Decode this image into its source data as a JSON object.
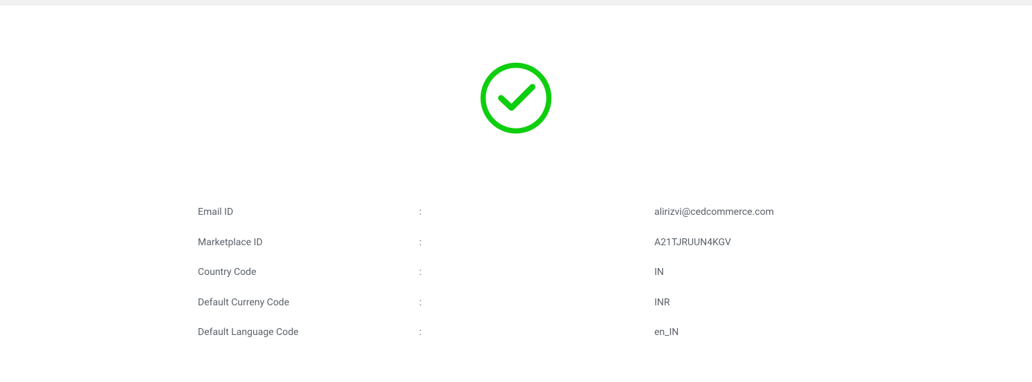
{
  "icon": {
    "color": "#0fce0f"
  },
  "details": {
    "rows": [
      {
        "label": "Email ID",
        "sep": ":",
        "value": "alirizvi@cedcommerce.com"
      },
      {
        "label": "Marketplace ID",
        "sep": ":",
        "value": "A21TJRUUN4KGV"
      },
      {
        "label": "Country Code",
        "sep": ":",
        "value": "IN"
      },
      {
        "label": "Default Curreny Code",
        "sep": ":",
        "value": "INR"
      },
      {
        "label": "Default Language Code",
        "sep": ":",
        "value": "en_IN"
      }
    ]
  }
}
